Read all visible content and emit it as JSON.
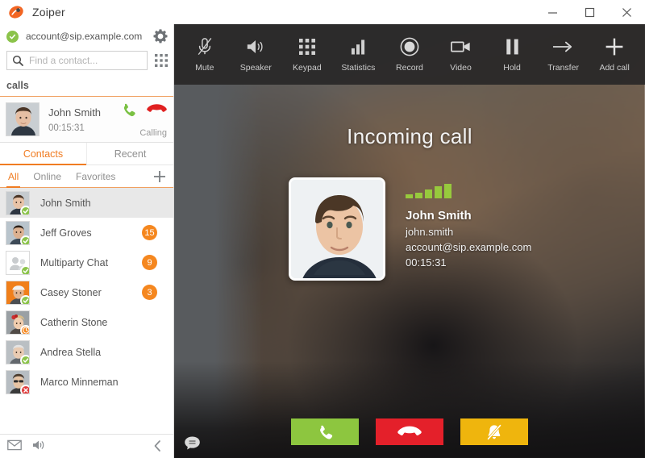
{
  "window": {
    "title": "Zoiper",
    "minimize_label": "Minimize",
    "maximize_label": "Maximize",
    "close_label": "Close"
  },
  "sidebar": {
    "account": {
      "name": "account@sip.example.com",
      "status": "online",
      "settings_label": "Settings"
    },
    "search": {
      "placeholder": "Find a contact...",
      "value": ""
    },
    "dialpad_label": "Dialpad",
    "calls_header": "calls",
    "active_call": {
      "name": "John Smith",
      "duration": "00:15:31",
      "status": "Calling",
      "answer_label": "Answer",
      "decline_label": "Decline"
    },
    "tabs": [
      {
        "label": "Contacts",
        "active": true
      },
      {
        "label": "Recent",
        "active": false
      }
    ],
    "subtabs": [
      {
        "label": "All",
        "active": true
      },
      {
        "label": "Online",
        "active": false
      },
      {
        "label": "Favorites",
        "active": false
      }
    ],
    "add_contact_label": "Add contact",
    "contacts": [
      {
        "name": "John Smith",
        "presence": "online",
        "count": "",
        "selected": true,
        "avatar": "photo-man-1"
      },
      {
        "name": "Jeff Groves",
        "presence": "online",
        "count": "15",
        "selected": false,
        "avatar": "photo-man-2"
      },
      {
        "name": "Multiparty Chat",
        "presence": "online",
        "count": "9",
        "selected": false,
        "avatar": "group-placeholder"
      },
      {
        "name": "Casey Stoner",
        "presence": "online",
        "count": "3",
        "selected": false,
        "avatar": "photo-man-3"
      },
      {
        "name": "Catherin Stone",
        "presence": "away",
        "count": "",
        "selected": false,
        "avatar": "photo-woman-1"
      },
      {
        "name": "Andrea Stella",
        "presence": "online",
        "count": "",
        "selected": false,
        "avatar": "photo-man-4"
      },
      {
        "name": "Marco Minneman",
        "presence": "offline",
        "count": "",
        "selected": false,
        "avatar": "photo-woman-2"
      }
    ],
    "statusbar": {
      "voicemail_label": "Voicemail",
      "volume_label": "Volume",
      "collapse_label": "Collapse panel"
    }
  },
  "call_panel": {
    "toolbar": [
      {
        "label": "Mute",
        "icon": "microphone-muted-icon"
      },
      {
        "label": "Speaker",
        "icon": "speaker-icon"
      },
      {
        "label": "Keypad",
        "icon": "keypad-icon"
      },
      {
        "label": "Statistics",
        "icon": "bar-chart-icon"
      },
      {
        "label": "Record",
        "icon": "record-icon"
      },
      {
        "label": "Video",
        "icon": "video-camera-icon"
      },
      {
        "label": "Hold",
        "icon": "pause-icon"
      },
      {
        "label": "Transfer",
        "icon": "arrow-right-icon"
      },
      {
        "label": "Add call",
        "icon": "plus-icon"
      }
    ],
    "headline": "Incoming call",
    "peer": {
      "name": "John Smith",
      "username": "john.smith",
      "account": "account@sip.example.com",
      "duration": "00:15:31",
      "signal_bars": 5
    },
    "actions": [
      {
        "label": "Answer call",
        "icon": "phone-icon",
        "color": "#8dc63f"
      },
      {
        "label": "Decline call",
        "icon": "phone-hangup-icon",
        "color": "#e4202a"
      },
      {
        "label": "Silence ringtone",
        "icon": "bell-muted-icon",
        "color": "#efb50d"
      }
    ],
    "chat_label": "Chat"
  },
  "colors": {
    "accent": "#f07c22",
    "online": "#8bc34a",
    "away": "#f5871f",
    "offline": "#e03b3b",
    "badge": "#f5871f"
  }
}
